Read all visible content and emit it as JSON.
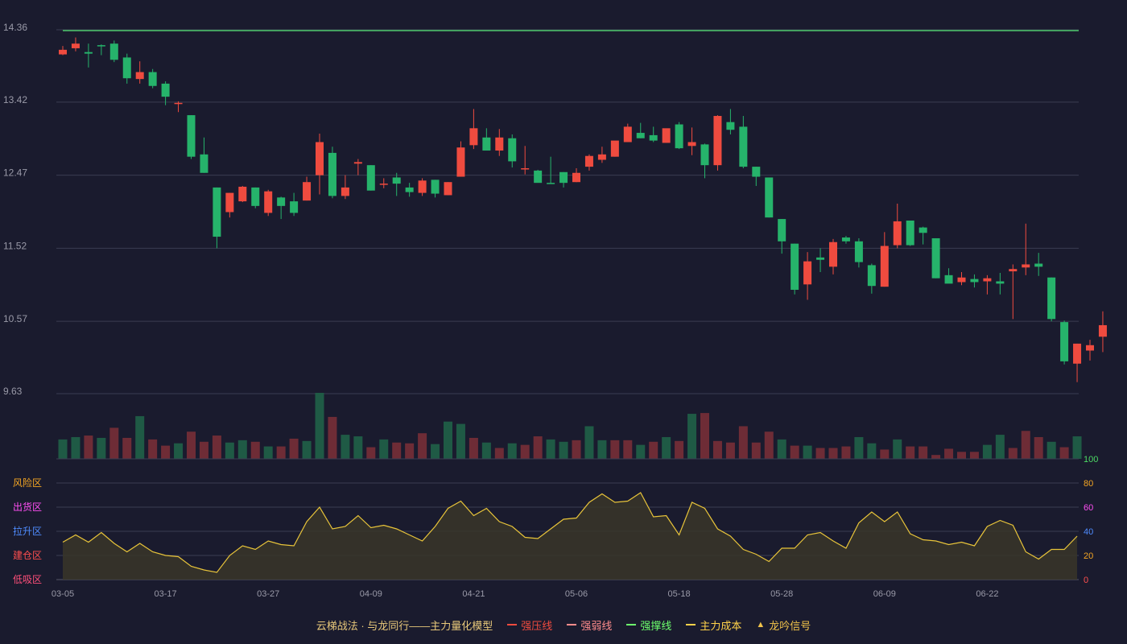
{
  "legend": {
    "title": "云梯战法 · 与龙同行——主力量化模型",
    "items": [
      {
        "label": "强压线",
        "color": "#ef4b3f",
        "style": "solid"
      },
      {
        "label": "强弱线",
        "color": "#ff8c8c",
        "style": "dashed"
      },
      {
        "label": "强撑线",
        "color": "#6dff6d",
        "style": "solid"
      },
      {
        "label": "主力成本",
        "color": "#ffd24a",
        "style": "dashed"
      },
      {
        "label": "龙吟信号",
        "color": "#f0c24a",
        "style": "triangle"
      }
    ]
  },
  "colors": {
    "up": "#ef4b3f",
    "down": "#26b36b",
    "up_vol": "#6e2c36",
    "down_vol": "#1f5a45",
    "grid": "#3b3d52",
    "axis_text": "#9a9aa8",
    "line14": "#4cc86b",
    "osc_line": "#e8c43a",
    "osc_fill": "#3a3528"
  },
  "chart_data": {
    "type": "candlestick",
    "price_axis": {
      "ticks": [
        "14.36",
        "13.42",
        "12.47",
        "11.52",
        "10.57",
        "9.63"
      ],
      "ylim": [
        9.63,
        14.36
      ]
    },
    "reference_line": 14.36,
    "x_labels": [
      {
        "index": 0,
        "label": "03-05"
      },
      {
        "index": 8,
        "label": "03-17"
      },
      {
        "index": 16,
        "label": "03-27"
      },
      {
        "index": 24,
        "label": "04-09"
      },
      {
        "index": 32,
        "label": "04-21"
      },
      {
        "index": 40,
        "label": "05-06"
      },
      {
        "index": 48,
        "label": "05-18"
      },
      {
        "index": 56,
        "label": "05-28"
      },
      {
        "index": 64,
        "label": "06-09"
      },
      {
        "index": 72,
        "label": "06-22"
      }
    ],
    "candles": [
      [
        14.04,
        14.1,
        14.03,
        14.15
      ],
      [
        14.12,
        14.18,
        14.08,
        14.26
      ],
      [
        14.07,
        14.05,
        13.87,
        14.18
      ],
      [
        14.16,
        14.15,
        14.03,
        14.17
      ],
      [
        14.18,
        13.97,
        13.94,
        14.22
      ],
      [
        14.0,
        13.73,
        13.66,
        14.05
      ],
      [
        13.72,
        13.81,
        13.66,
        13.95
      ],
      [
        13.81,
        13.63,
        13.6,
        13.85
      ],
      [
        13.66,
        13.49,
        13.38,
        13.69
      ],
      [
        13.4,
        13.41,
        13.29,
        13.43
      ],
      [
        13.25,
        12.71,
        12.68,
        13.25
      ],
      [
        12.74,
        12.5,
        12.5,
        12.96
      ],
      [
        12.31,
        11.67,
        11.52,
        12.31
      ],
      [
        11.99,
        12.24,
        11.92,
        12.24
      ],
      [
        12.13,
        12.32,
        12.12,
        12.33
      ],
      [
        12.31,
        12.07,
        12.04,
        12.31
      ],
      [
        11.98,
        12.26,
        11.94,
        12.28
      ],
      [
        12.18,
        12.07,
        11.9,
        12.19
      ],
      [
        12.13,
        11.98,
        11.94,
        12.24
      ],
      [
        12.14,
        12.38,
        12.14,
        12.45
      ],
      [
        12.47,
        12.9,
        12.22,
        13.01
      ],
      [
        12.76,
        12.2,
        12.17,
        12.84
      ],
      [
        12.2,
        12.31,
        12.16,
        12.47
      ],
      [
        12.62,
        12.64,
        12.47,
        12.68
      ],
      [
        12.6,
        12.27,
        12.27,
        12.6
      ],
      [
        12.36,
        12.36,
        12.3,
        12.43
      ],
      [
        12.44,
        12.36,
        12.2,
        12.5
      ],
      [
        12.31,
        12.25,
        12.19,
        12.37
      ],
      [
        12.24,
        12.4,
        12.2,
        12.43
      ],
      [
        12.41,
        12.23,
        12.18,
        12.41
      ],
      [
        12.21,
        12.38,
        12.21,
        12.38
      ],
      [
        12.45,
        12.83,
        12.45,
        12.91
      ],
      [
        12.86,
        13.08,
        12.81,
        13.33
      ],
      [
        12.96,
        12.79,
        12.8,
        13.08
      ],
      [
        12.79,
        12.96,
        12.72,
        13.07
      ],
      [
        12.95,
        12.65,
        12.57,
        13.0
      ],
      [
        12.55,
        12.56,
        12.48,
        12.85
      ],
      [
        12.53,
        12.37,
        12.38,
        12.54
      ],
      [
        12.37,
        12.36,
        12.36,
        12.71
      ],
      [
        12.51,
        12.37,
        12.31,
        12.51
      ],
      [
        12.38,
        12.5,
        12.38,
        12.56
      ],
      [
        12.58,
        12.72,
        12.53,
        12.74
      ],
      [
        12.67,
        12.74,
        12.63,
        12.84
      ],
      [
        12.71,
        12.92,
        12.71,
        12.9
      ],
      [
        12.9,
        13.1,
        12.9,
        13.14
      ],
      [
        13.02,
        12.95,
        12.95,
        13.15
      ],
      [
        12.99,
        12.92,
        12.9,
        13.1
      ],
      [
        12.89,
        13.08,
        12.89,
        13.07
      ],
      [
        13.13,
        12.82,
        12.81,
        13.16
      ],
      [
        12.85,
        12.9,
        12.73,
        13.09
      ],
      [
        12.87,
        12.6,
        12.43,
        12.88
      ],
      [
        12.6,
        13.24,
        12.53,
        13.25
      ],
      [
        13.16,
        13.06,
        13.0,
        13.33
      ],
      [
        13.1,
        12.58,
        12.56,
        13.24
      ],
      [
        12.58,
        12.45,
        12.33,
        12.58
      ],
      [
        12.44,
        11.92,
        11.92,
        12.44
      ],
      [
        11.9,
        11.61,
        11.45,
        11.9
      ],
      [
        11.58,
        10.98,
        10.92,
        11.58
      ],
      [
        11.05,
        11.35,
        10.85,
        11.47
      ],
      [
        11.4,
        11.37,
        11.21,
        11.52
      ],
      [
        11.28,
        11.6,
        11.18,
        11.64
      ],
      [
        11.66,
        11.61,
        11.58,
        11.68
      ],
      [
        11.61,
        11.34,
        11.27,
        11.65
      ],
      [
        11.3,
        11.03,
        10.93,
        11.32
      ],
      [
        11.02,
        11.55,
        11.02,
        11.73
      ],
      [
        11.56,
        11.87,
        11.52,
        12.1
      ],
      [
        11.88,
        11.56,
        11.55,
        11.87
      ],
      [
        11.79,
        11.72,
        11.57,
        11.8
      ],
      [
        11.65,
        11.13,
        11.13,
        11.65
      ],
      [
        11.17,
        11.06,
        11.07,
        11.26
      ],
      [
        11.08,
        11.14,
        11.04,
        11.21
      ],
      [
        11.12,
        11.08,
        11.01,
        11.18
      ],
      [
        11.09,
        11.13,
        10.92,
        11.17
      ],
      [
        11.09,
        11.06,
        10.92,
        11.2
      ],
      [
        11.22,
        11.25,
        10.6,
        11.31
      ],
      [
        11.27,
        11.31,
        11.17,
        11.84
      ],
      [
        11.32,
        11.28,
        11.16,
        11.46
      ],
      [
        11.14,
        10.6,
        10.57,
        11.14
      ],
      [
        10.56,
        10.05,
        10.01,
        10.58
      ],
      [
        10.02,
        10.28,
        9.78,
        10.28
      ],
      [
        10.19,
        10.26,
        10.06,
        10.33
      ],
      [
        10.37,
        10.52,
        10.17,
        10.7
      ]
    ],
    "volume": [
      [
        25,
        0
      ],
      [
        28,
        0
      ],
      [
        30,
        1
      ],
      [
        27,
        0
      ],
      [
        40,
        1
      ],
      [
        27,
        1
      ],
      [
        55,
        0
      ],
      [
        25,
        1
      ],
      [
        17,
        1
      ],
      [
        20,
        0
      ],
      [
        35,
        1
      ],
      [
        22,
        1
      ],
      [
        30,
        1
      ],
      [
        21,
        0
      ],
      [
        24,
        0
      ],
      [
        22,
        1
      ],
      [
        16,
        0
      ],
      [
        16,
        1
      ],
      [
        26,
        1
      ],
      [
        23,
        0
      ],
      [
        85,
        0
      ],
      [
        54,
        1
      ],
      [
        31,
        0
      ],
      [
        29,
        0
      ],
      [
        15,
        1
      ],
      [
        25,
        0
      ],
      [
        21,
        1
      ],
      [
        20,
        1
      ],
      [
        33,
        1
      ],
      [
        19,
        0
      ],
      [
        48,
        0
      ],
      [
        45,
        0
      ],
      [
        27,
        1
      ],
      [
        21,
        0
      ],
      [
        14,
        1
      ],
      [
        20,
        0
      ],
      [
        18,
        1
      ],
      [
        29,
        1
      ],
      [
        25,
        0
      ],
      [
        22,
        0
      ],
      [
        24,
        1
      ],
      [
        42,
        0
      ],
      [
        24,
        0
      ],
      [
        24,
        1
      ],
      [
        24,
        1
      ],
      [
        18,
        0
      ],
      [
        22,
        1
      ],
      [
        28,
        0
      ],
      [
        23,
        1
      ],
      [
        58,
        0
      ],
      [
        59,
        1
      ],
      [
        23,
        1
      ],
      [
        21,
        1
      ],
      [
        42,
        1
      ],
      [
        21,
        1
      ],
      [
        35,
        1
      ],
      [
        25,
        0
      ],
      [
        17,
        1
      ],
      [
        17,
        0
      ],
      [
        14,
        1
      ],
      [
        14,
        1
      ],
      [
        16,
        1
      ],
      [
        28,
        0
      ],
      [
        20,
        0
      ],
      [
        12,
        1
      ],
      [
        25,
        0
      ],
      [
        16,
        1
      ],
      [
        16,
        1
      ],
      [
        5,
        1
      ],
      [
        13,
        1
      ],
      [
        9,
        1
      ],
      [
        9,
        1
      ],
      [
        18,
        0
      ],
      [
        31,
        0
      ],
      [
        14,
        1
      ],
      [
        36,
        1
      ],
      [
        28,
        1
      ],
      [
        22,
        0
      ],
      [
        15,
        1
      ],
      [
        29,
        0
      ]
    ],
    "oscillator": {
      "zones": [
        "风险区",
        "出货区",
        "拉升区",
        "建仓区",
        "低吸区"
      ],
      "zone_colors": [
        "#f5a623",
        "#ff4ff4",
        "#4f8cff",
        "#ff4f4f",
        "#ff4f7a"
      ],
      "right_ticks": [
        "100",
        "80",
        "60",
        "40",
        "20",
        "0"
      ],
      "right_tick_colors": [
        "#4cd964",
        "#f5a623",
        "#ff4ff4",
        "#4f8cff",
        "#f5a623",
        "#ff4f4f"
      ],
      "ylim": [
        0,
        100
      ],
      "values": [
        31,
        37,
        31,
        39,
        30,
        23,
        30,
        23,
        20,
        19,
        11,
        8,
        6,
        20,
        28,
        25,
        32,
        29,
        28,
        48,
        60,
        42,
        44,
        53,
        43,
        45,
        42,
        37,
        32,
        44,
        59,
        65,
        53,
        59,
        48,
        44,
        35,
        34,
        42,
        50,
        51,
        64,
        71,
        64,
        65,
        72,
        52,
        53,
        37,
        64,
        59,
        42,
        36,
        25,
        21,
        15,
        26,
        26,
        37,
        39,
        32,
        26,
        47,
        56,
        48,
        56,
        38,
        33,
        32,
        29,
        31,
        28,
        44,
        49,
        45,
        23,
        17,
        25,
        25,
        36
      ]
    }
  }
}
